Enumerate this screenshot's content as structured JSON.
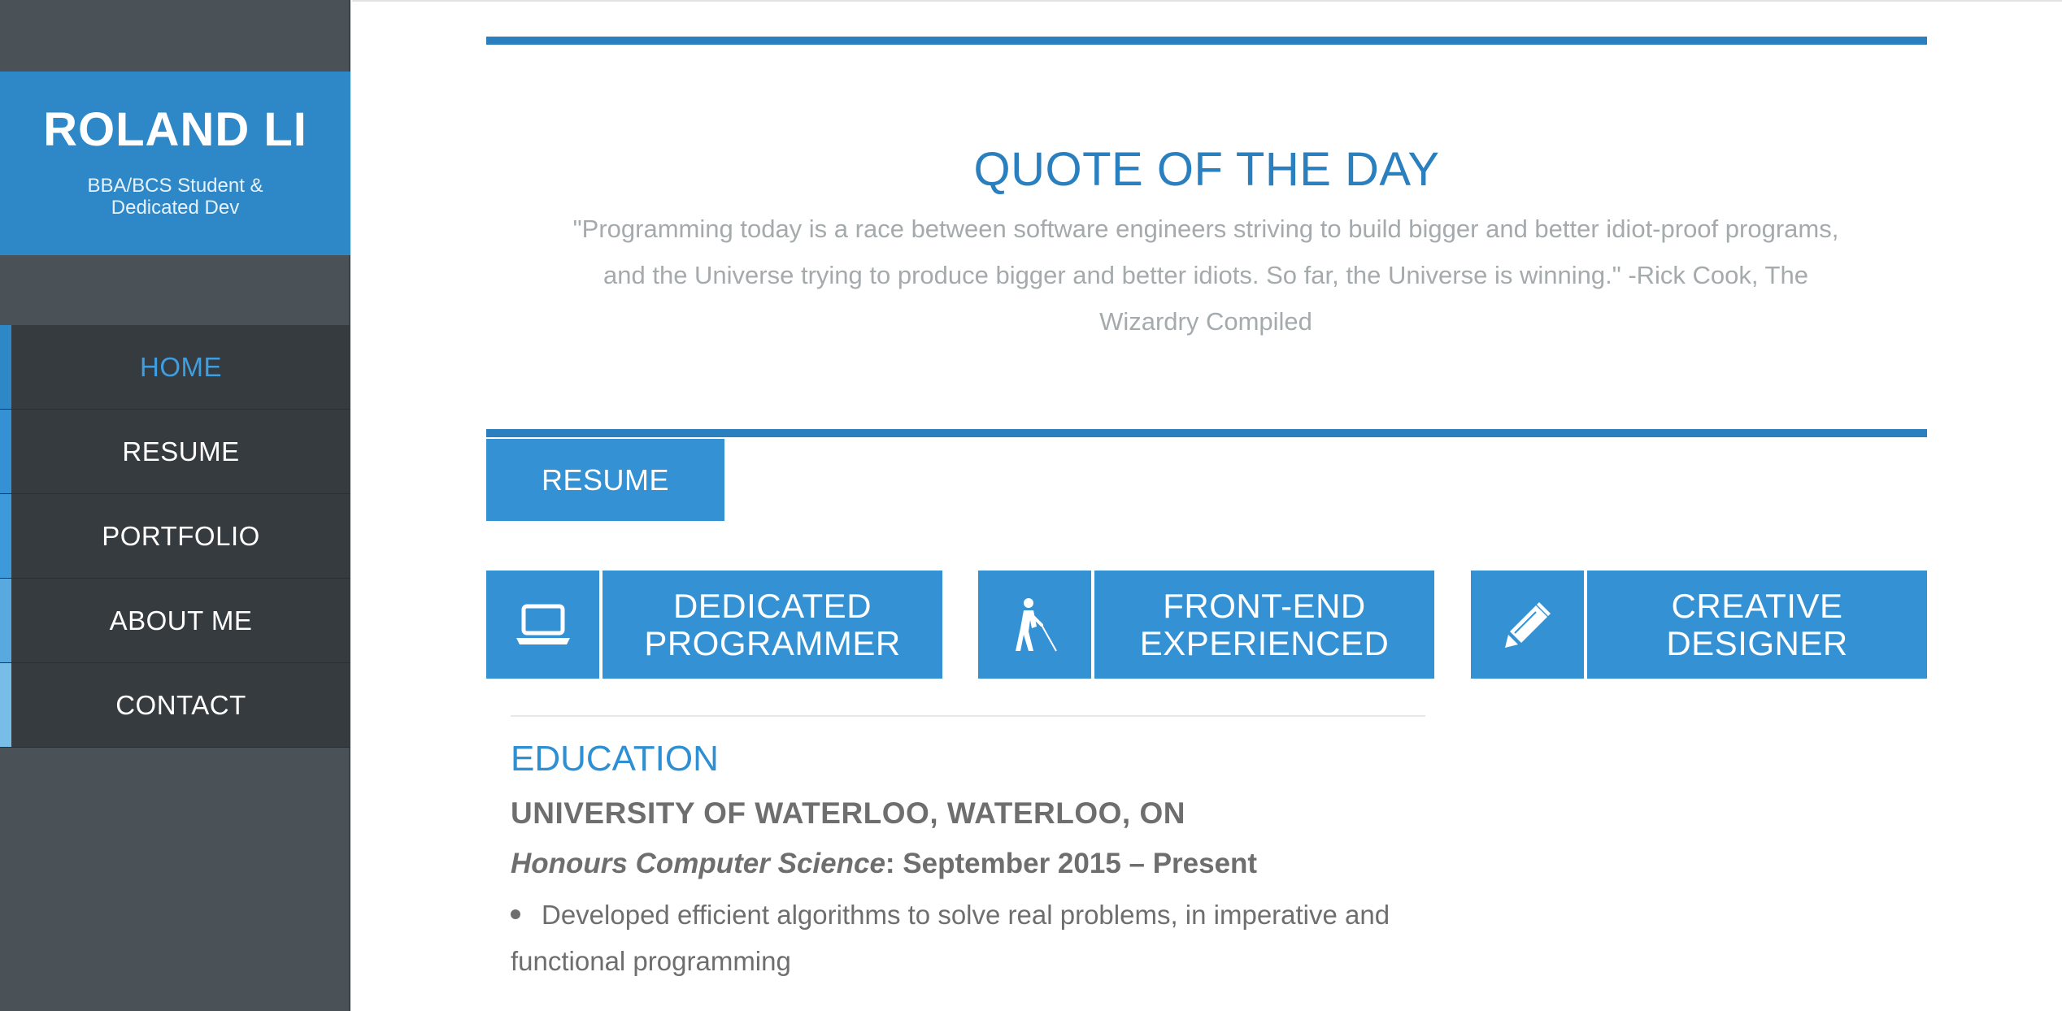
{
  "sidebar": {
    "brand_name": "ROLAND LI",
    "tagline": "BBA/BCS Student & Dedicated Dev",
    "nav": [
      {
        "label": "HOME",
        "stripe": "#2e87c7"
      },
      {
        "label": "RESUME",
        "stripe": "#3391d4"
      },
      {
        "label": "PORTFOLIO",
        "stripe": "#3d9ada"
      },
      {
        "label": "ABOUT ME",
        "stripe": "#57a9e0"
      },
      {
        "label": "CONTACT",
        "stripe": "#78bde8"
      }
    ],
    "active_item": "HOME"
  },
  "quote": {
    "title": "QUOTE OF THE DAY",
    "text": "\"Programming today is a race between software engineers striving to build bigger and better idiot-proof programs, and the Universe trying to produce bigger and better idiots. So far, the Universe is winning.\" -Rick Cook, The Wizardry Compiled"
  },
  "resume_tab": {
    "label": "RESUME"
  },
  "features": [
    {
      "icon": "laptop-icon",
      "label": "DEDICATED PROGRAMMER"
    },
    {
      "icon": "blind-person-icon",
      "label": "FRONT-END EXPERIENCED"
    },
    {
      "icon": "pencil-icon",
      "label": "CREATIVE DESIGNER"
    }
  ],
  "education": {
    "heading": "EDUCATION",
    "school": "UNIVERSITY OF WATERLOO, WATERLOO, ON",
    "program": "Honours Computer Science",
    "dates": ": September 2015 – Present",
    "bullets": [
      "Developed efficient algorithms to solve real problems, in imperative and functional programming"
    ]
  },
  "colors": {
    "accent": "#2a7fbf",
    "tile": "#3391d4",
    "sidebar_bg": "#4b5257",
    "nav_bg": "#363b40",
    "text_gray": "#6e6e6e"
  }
}
